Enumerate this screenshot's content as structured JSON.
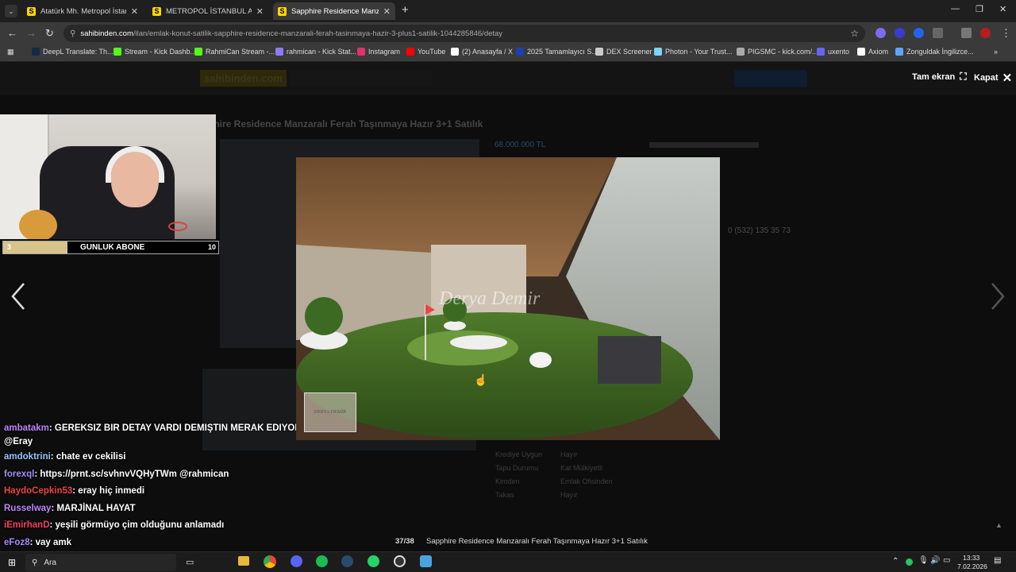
{
  "browser": {
    "tabs": [
      {
        "title": "Atatürk Mh. Metropol İstanbul A",
        "icon": "S"
      },
      {
        "title": "METROPOL İSTANBUL A BLOK 1...",
        "icon": "S"
      },
      {
        "title": "Sapphire Residence Manzaralı F",
        "icon": "S"
      }
    ],
    "new_tab": "+",
    "url_domain": "sahibinden.com",
    "url_path": "/ilan/emlak-konut-satilik-sapphire-residence-manzarali-ferah-tasinmaya-hazir-3-plus1-satilik-1044285846/detay"
  },
  "bookmarks": [
    {
      "label": "DeepL Translate: Th...",
      "color": "#0f2b46"
    },
    {
      "label": "Stream - Kick Dashb...",
      "color": "#53fc18"
    },
    {
      "label": "RahmiCan Stream -...",
      "color": "#53fc18"
    },
    {
      "label": "rahmican - Kick Stat...",
      "color": "#8b7cf6"
    },
    {
      "label": "Instagram",
      "color": "#e1306c"
    },
    {
      "label": "YouTube",
      "color": "#ff0000"
    },
    {
      "label": "(2) Anasayfa / X",
      "color": "#ffffff"
    },
    {
      "label": "2025 Tamamlayıcı S...",
      "color": "#1e40af"
    },
    {
      "label": "DEX Screener",
      "color": "#cccccc"
    },
    {
      "label": "Photon - Your Trust...",
      "color": "#7dd3fc"
    },
    {
      "label": "PIGSMC - kick.com/...",
      "color": "#aaaaaa"
    },
    {
      "label": "uxento",
      "color": "#6366f1"
    },
    {
      "label": "Axiom",
      "color": "#ffffff"
    },
    {
      "label": "Zonguldak İngilizce...",
      "color": "#60a5fa"
    }
  ],
  "viewer": {
    "fullscreen_label": "Tam ekran",
    "close_label": "Kapat",
    "counter": "37/38",
    "caption": "Sapphire Residence Manzaralı Ferah Taşınmaya Hazır 3+1 Satılık",
    "watermark": "Derya Demir",
    "watermark_small": "DERYA DEMİR"
  },
  "background_page": {
    "logo": "sahibinden.com",
    "title": "phire Residence Manzaralı Ferah Taşınmaya Hazır 3+1 Satılık",
    "price": "68.000.000 TL",
    "phone": "0 (532) 135 35 73",
    "rows": [
      {
        "key": "Krediye Uygun",
        "value": "Hayır"
      },
      {
        "key": "Tapu Durumu",
        "value": "Kat Mülkiyetli"
      },
      {
        "key": "Kimden",
        "value": "Emlak Ofisinden"
      },
      {
        "key": "Takas",
        "value": "Hayır"
      }
    ]
  },
  "stream": {
    "sub_goal_current": "3",
    "sub_goal_label": "GUNLUK ABONE",
    "sub_goal_target": "10",
    "sub_goal_progress": 0.3
  },
  "chat": [
    {
      "user": "ambatakm",
      "color": "#c084fc",
      "msg": ": GEREKSIZ BIR DETAY VARDI DEMIŞTIN MERAK EDIYORUZ"
    },
    {
      "user": "",
      "color": "#ffffff",
      "msg": "@Eray"
    },
    {
      "user": "amdoktrini",
      "color": "#93c5fd",
      "msg": ": chate ev cekilisi"
    },
    {
      "user": "forexql",
      "color": "#a78bfa",
      "msg": ": https://prnt.sc/svhnvVQHyTWm @rahmican"
    },
    {
      "user": "HaydoCepkin53",
      "color": "#ef4444",
      "msg": ": eray hiç inmedi"
    },
    {
      "user": "Russelway",
      "color": "#c084fc",
      "msg": ": MARJİNAL HAYAT"
    },
    {
      "user": "iEmirhanD",
      "color": "#f43f5e",
      "msg": ": yeşili görmüyo çim olduğunu anlamadı"
    },
    {
      "user": "eFoz8",
      "color": "#a78bfa",
      "msg": ": vay amk"
    }
  ],
  "taskbar": {
    "search_placeholder": "Ara",
    "time": "13:33",
    "date": "7.02.2026"
  }
}
